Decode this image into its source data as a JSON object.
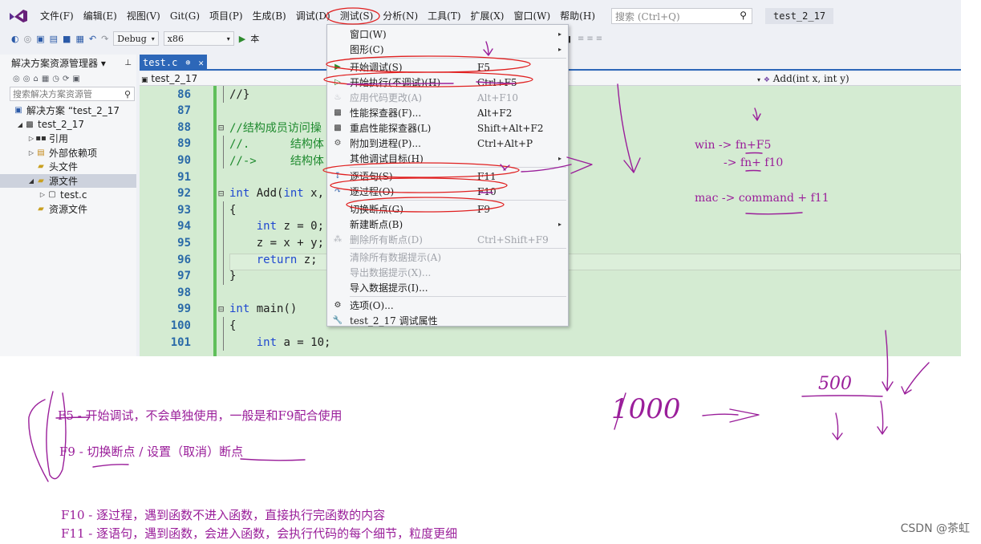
{
  "menubar": {
    "items": [
      "文件(F)",
      "编辑(E)",
      "视图(V)",
      "Git(G)",
      "项目(P)",
      "生成(B)",
      "调试(D)",
      "测试(S)",
      "分析(N)",
      "工具(T)",
      "扩展(X)",
      "窗口(W)",
      "帮助(H)"
    ],
    "search_placeholder": "搜索 (Ctrl+Q)",
    "solution_name": "test_2_17"
  },
  "toolbar": {
    "config": "Debug",
    "platform": "x86",
    "run_label": "本"
  },
  "solution_explorer": {
    "title": "解决方案资源管理器 ▾",
    "search_placeholder": "搜索解决方案资源管",
    "tree": [
      {
        "label": "解决方案 “test_2_17",
        "indent": 0,
        "arrow": "",
        "icon": "solution-icon"
      },
      {
        "label": "test_2_17",
        "indent": 1,
        "arrow": "◢",
        "icon": "project-icon"
      },
      {
        "label": "引用",
        "indent": 2,
        "arrow": "▷",
        "icon": "references-icon"
      },
      {
        "label": "外部依赖项",
        "indent": 2,
        "arrow": "▷",
        "icon": "dependencies-icon"
      },
      {
        "label": "头文件",
        "indent": 2,
        "arrow": "",
        "icon": "folder-icon"
      },
      {
        "label": "源文件",
        "indent": 2,
        "arrow": "◢",
        "icon": "folder-icon",
        "selected": true
      },
      {
        "label": "test.c",
        "indent": 3,
        "arrow": "▷",
        "icon": "file-icon"
      },
      {
        "label": "资源文件",
        "indent": 2,
        "arrow": "",
        "icon": "folder-icon"
      }
    ]
  },
  "editor": {
    "tab_label": "test.c",
    "tab_pin": "⊕",
    "tab_close": "✕",
    "nav_project": "test_2_17",
    "nav_function": "Add(int x, int y)",
    "lines": [
      {
        "n": "86",
        "fold": "",
        "html": "<span>//}</span>"
      },
      {
        "n": "87",
        "fold": "",
        "html": ""
      },
      {
        "n": "88",
        "fold": "⊟",
        "html": "<span class='cm'>//结构成员访问操</span>"
      },
      {
        "n": "89",
        "fold": "",
        "html": "<span class='cm'>//.      结构体</span>"
      },
      {
        "n": "90",
        "fold": "",
        "html": "<span class='cm'>//->     结构体</span>"
      },
      {
        "n": "91",
        "fold": "",
        "html": ""
      },
      {
        "n": "92",
        "fold": "⊟",
        "html": "<span class='kw'>int</span> Add(<span class='kw'>int</span> x,"
      },
      {
        "n": "93",
        "fold": "",
        "html": "{"
      },
      {
        "n": "94",
        "fold": "",
        "html": "    <span class='kw'>int</span> z = 0;"
      },
      {
        "n": "95",
        "fold": "",
        "html": "    z = x + y;"
      },
      {
        "n": "96",
        "fold": "",
        "html": "    <span class='kw'>return</span> z;"
      },
      {
        "n": "97",
        "fold": "",
        "html": "}"
      },
      {
        "n": "98",
        "fold": "",
        "html": ""
      },
      {
        "n": "99",
        "fold": "⊟",
        "html": "<span class='kw'>int</span> main()"
      },
      {
        "n": "100",
        "fold": "",
        "html": "{"
      },
      {
        "n": "101",
        "fold": "",
        "html": "    <span class='kw'>int</span> a = 10;"
      }
    ]
  },
  "debug_menu": {
    "items": [
      {
        "label": "窗口(W)",
        "shortcut": "",
        "icon": "",
        "submenu": true,
        "disabled": false
      },
      {
        "label": "图形(C)",
        "shortcut": "",
        "icon": "",
        "submenu": true,
        "disabled": false
      },
      {
        "sep": true
      },
      {
        "label": "开始调试(S)",
        "shortcut": "F5",
        "icon": "start-debug-icon",
        "submenu": false,
        "disabled": false
      },
      {
        "label": "开始执行(不调试)(H)",
        "shortcut": "Ctrl+F5",
        "icon": "start-without-debug-icon",
        "submenu": false,
        "disabled": false
      },
      {
        "label": "应用代码更改(A)",
        "shortcut": "Alt+F10",
        "icon": "apply-changes-icon",
        "submenu": false,
        "disabled": true
      },
      {
        "label": "性能探查器(F)...",
        "shortcut": "Alt+F2",
        "icon": "profiler-icon",
        "submenu": false,
        "disabled": false
      },
      {
        "label": "重启性能探查器(L)",
        "shortcut": "Shift+Alt+F2",
        "icon": "restart-profiler-icon",
        "submenu": false,
        "disabled": false
      },
      {
        "label": "附加到进程(P)...",
        "shortcut": "Ctrl+Alt+P",
        "icon": "attach-icon",
        "submenu": false,
        "disabled": false
      },
      {
        "label": "其他调试目标(H)",
        "shortcut": "",
        "icon": "",
        "submenu": true,
        "disabled": false
      },
      {
        "sep": true
      },
      {
        "label": "逐语句(S)",
        "shortcut": "F11",
        "icon": "step-into-icon",
        "submenu": false,
        "disabled": false
      },
      {
        "label": "逐过程(O)",
        "shortcut": "F10",
        "icon": "step-over-icon",
        "submenu": false,
        "disabled": false
      },
      {
        "sep": true
      },
      {
        "label": "切换断点(G)",
        "shortcut": "F9",
        "icon": "",
        "submenu": false,
        "disabled": false
      },
      {
        "label": "新建断点(B)",
        "shortcut": "",
        "icon": "",
        "submenu": true,
        "disabled": false
      },
      {
        "label": "删除所有断点(D)",
        "shortcut": "Ctrl+Shift+F9",
        "icon": "delete-breakpoints-icon",
        "submenu": false,
        "disabled": true
      },
      {
        "sep": true
      },
      {
        "label": "清除所有数据提示(A)",
        "shortcut": "",
        "icon": "",
        "submenu": false,
        "disabled": true
      },
      {
        "label": "导出数据提示(X)...",
        "shortcut": "",
        "icon": "",
        "submenu": false,
        "disabled": true
      },
      {
        "label": "导入数据提示(I)...",
        "shortcut": "",
        "icon": "",
        "submenu": false,
        "disabled": false
      },
      {
        "sep": true
      },
      {
        "label": "选项(O)...",
        "shortcut": "",
        "icon": "gear-icon",
        "submenu": false,
        "disabled": false
      },
      {
        "label": "test_2_17 调试属性",
        "shortcut": "",
        "icon": "wrench-icon",
        "submenu": false,
        "disabled": false
      }
    ]
  },
  "notes": {
    "win_line1": "win -> fn+F5",
    "win_line2": "-> fn+ f10",
    "mac_line": "mac -> command + f11",
    "f5_note": "F5 - 开始调试，不会单独使用，一般是和F9配合使用",
    "f9_note": "F9 - 切换断点 / 设置（取消）断点",
    "f10_note": "F10 - 逐过程，遇到函数不进入函数，直接执行完函数的内容",
    "f11_note": "F11 - 逐语句，遇到函数，会进入函数，会执行代码的每个细节，粒度更细",
    "hand_1000": "1000",
    "hand_500": "500",
    "accent_color": "#9a1e9a",
    "circle_color": "#e02020"
  },
  "watermark": "CSDN @茶虹"
}
